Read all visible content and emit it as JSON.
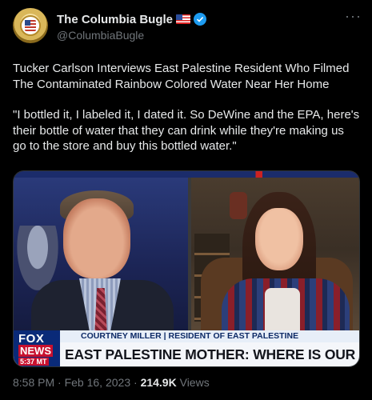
{
  "account": {
    "display_name": "The Columbia Bugle",
    "handle": "@ColumbiaBugle",
    "verified": true,
    "flag_icon": "us-flag-icon"
  },
  "more_icon": "···",
  "tweet": {
    "paragraphs": [
      "Tucker Carlson Interviews East Palestine Resident Who Filmed The Contaminated Rainbow Colored Water Near Her Home",
      "\"I bottled it, I labeled it, I dated it. So DeWine and the EPA, here's their bottle of water that they can drink while they're making us go to the store and buy this bottled water.\""
    ]
  },
  "media": {
    "lower_third_name": "COURTNEY MILLER | RESIDENT OF EAST PALESTINE",
    "lower_third_headline": "EAST PALESTINE MOTHER: WHERE IS OUR HELP?",
    "network_logo_top": "FOX",
    "network_logo_bottom": "NEWS",
    "clock": "5:37 MT"
  },
  "meta": {
    "time": "8:58 PM",
    "separator": " · ",
    "date": "Feb 16, 2023",
    "views_count": "214.9K",
    "views_label": " Views"
  },
  "colors": {
    "background": "#000000",
    "text": "#e7e9ea",
    "secondary": "#71767b",
    "verified": "#1d9bf0"
  }
}
